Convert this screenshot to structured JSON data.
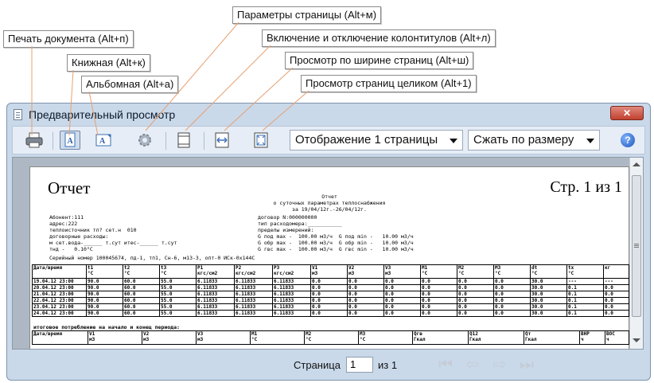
{
  "callouts": {
    "print": "Печать документа (Alt+п)",
    "portrait": "Книжная (Alt+к)",
    "landscape": "Альбомная (Alt+а)",
    "page_setup": "Параметры страницы (Alt+м)",
    "header_footer": "Включение и отключение колонтитулов (Alt+л)",
    "page_width": "Просмотр по ширине страниц (Alt+ш)",
    "whole_page": "Просмотр  страниц целиком (Alt+1)"
  },
  "window": {
    "title": "Предварительный просмотр",
    "close_label": "✕"
  },
  "toolbar": {
    "pages_combo": "Отображение 1 страницы",
    "zoom_combo": "Сжать по размеру",
    "help_label": "?"
  },
  "report": {
    "title": "Отчет",
    "page_label": "Стр. 1 из 1",
    "head_lines": [
      "Отчет",
      "о суточных параметрах теплоснабжения",
      "за 19/04/12г.-26/04/12г."
    ],
    "info_left": "Абонент:111\nадрес:222\nтеплоисточник тп? сет.н  010\nдоговорные расходы:\nм сет.вода-______ т.сут итес-______ т.сут\nтнд -   0.10°С",
    "info_right": "договор N:000000000\nтип расходомера:___________\nпределы измерений:\nG под max -  100.00 м3/ч  G под min -   10.00 м3/ч\nG обр max -  100.00 м3/ч  G обр min -   10.00 м3/ч\nG гвс max -  100.00 м3/ч  G гвс min -   10.00 м3/ч",
    "serial": "Серийный номер 100045674, пд-1, тп1, Сн-6, м13-3, опт-0 ИСк-0x144С",
    "table1": {
      "headers": [
        "Дата/время",
        "t1\n°С",
        "t2\n°С",
        "t3\n°С",
        "P1\nкгс/см2",
        "P2\nкгс/см2",
        "P3\nкгс/см2",
        "V1\nм3",
        "V2\nм3",
        "V3\nм3",
        "M1\n°С",
        "M2\n°С",
        "M3\n°С",
        "dt\n°С",
        "tx\n°С",
        "кг"
      ],
      "rows": [
        [
          "19.04.12 23:00",
          "90.0",
          "60.0",
          "55.0",
          "6.11833",
          "6.11833",
          "6.11833",
          "0.0",
          "0.0",
          "0.0",
          "0.0",
          "0.0",
          "0.0",
          "30.0",
          "---",
          "---"
        ],
        [
          "20.04.12 23:00",
          "90.0",
          "60.0",
          "55.0",
          "6.11833",
          "6.11833",
          "6.11833",
          "0.0",
          "0.0",
          "0.0",
          "0.0",
          "0.0",
          "0.0",
          "30.0",
          "0.1",
          "0.0"
        ],
        [
          "21.04.12 23:00",
          "90.0",
          "60.0",
          "55.0",
          "6.11833",
          "6.11833",
          "6.11833",
          "0.0",
          "0.0",
          "0.0",
          "0.0",
          "0.0",
          "0.0",
          "30.0",
          "0.1",
          "0.0"
        ],
        [
          "22.04.12 23:00",
          "90.0",
          "60.0",
          "55.0",
          "6.11833",
          "6.11833",
          "6.11833",
          "0.0",
          "0.0",
          "0.0",
          "0.0",
          "0.0",
          "0.0",
          "30.0",
          "0.1",
          "0.0"
        ],
        [
          "23.04.12 23:00",
          "90.0",
          "60.0",
          "55.0",
          "6.11833",
          "6.11833",
          "6.11833",
          "0.0",
          "0.0",
          "0.0",
          "0.0",
          "0.0",
          "0.0",
          "30.0",
          "0.1",
          "0.0"
        ],
        [
          "24.04.12 23:00",
          "90.0",
          "60.0",
          "55.0",
          "6.11833",
          "6.11833",
          "6.11833",
          "0.0",
          "0.0",
          "0.0",
          "0.0",
          "0.0",
          "0.0",
          "30.0",
          "0.1",
          "0.0"
        ]
      ],
      "footer_note": "итоговое потребление на начало и конец периода:"
    },
    "table2_headers": [
      "Дата/время",
      "V1\nм3",
      "V2\nм3",
      "V3\nм3",
      "M1\n°С",
      "M2\n°С",
      "M3\n°С",
      "Qгв\nГкал",
      "Q12\nГкал",
      "Qт\nГкал",
      "ВНР\nч",
      "ВОС\nч"
    ]
  },
  "status": {
    "page_label": "Страница",
    "page_value": "1",
    "page_of": "из 1"
  },
  "colors": {
    "window_frame": "#c9d9ea",
    "close_button": "#c2402f",
    "leader_lines": "#e8a070",
    "preview_background": "#aeb8c4"
  }
}
